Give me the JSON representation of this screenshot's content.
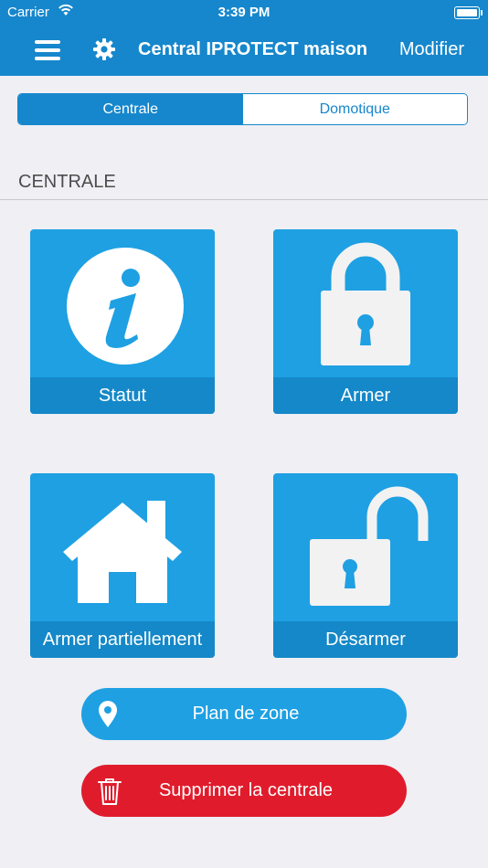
{
  "status_bar": {
    "carrier": "Carrier",
    "time": "3:39 PM"
  },
  "nav": {
    "title": "Central IPROTECT maison",
    "edit_label": "Modifier"
  },
  "segments": [
    {
      "label": "Centrale",
      "active": true
    },
    {
      "label": "Domotique",
      "active": false
    }
  ],
  "section": {
    "title": "CENTRALE"
  },
  "tiles": [
    {
      "label": "Statut",
      "icon": "info-icon"
    },
    {
      "label": "Armer",
      "icon": "padlock-locked-icon"
    },
    {
      "label": "Armer partiellement",
      "icon": "house-icon"
    },
    {
      "label": "Désarmer",
      "icon": "padlock-unlocked-icon"
    }
  ],
  "actions": {
    "zone_label": "Plan de zone",
    "delete_label": "Supprimer la centrale"
  },
  "colors": {
    "primary": "#1687cc",
    "tile": "#1ea0e3",
    "tile_label": "#1488c8",
    "danger": "#e01c2c",
    "background": "#efeff4"
  }
}
